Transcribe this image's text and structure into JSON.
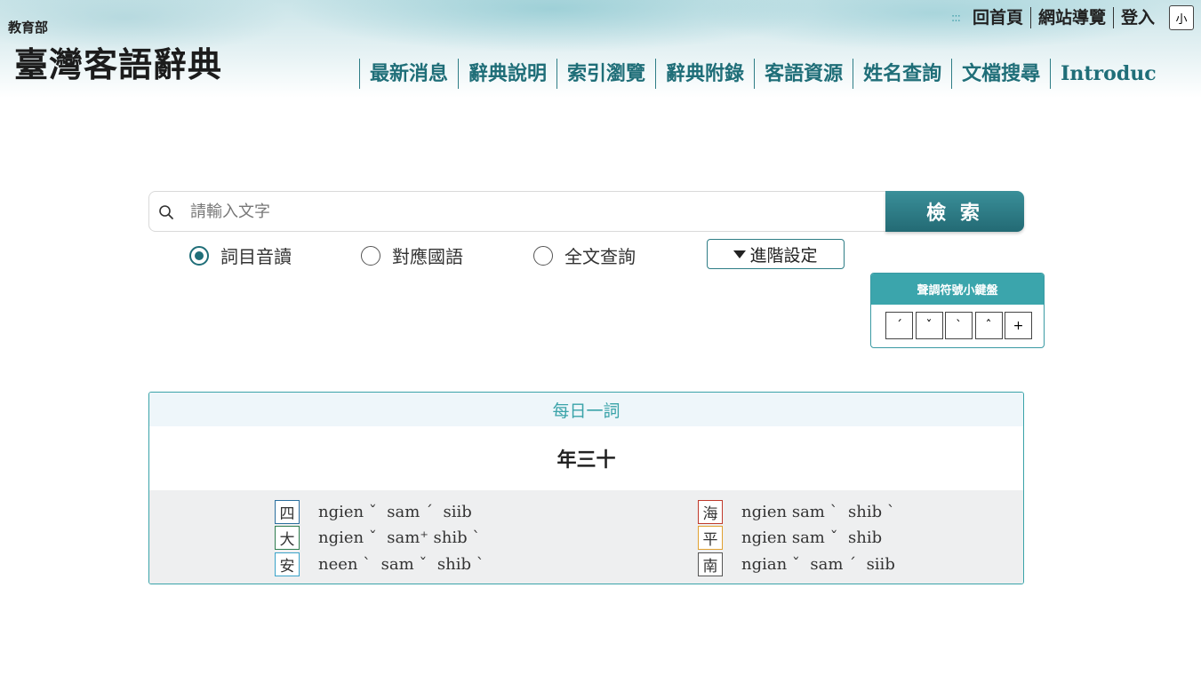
{
  "header": {
    "moe_label": "教育部",
    "site_title": "臺灣客語辭典",
    "top_links": [
      "回首頁",
      "網站導覽",
      "登入"
    ],
    "font_size_button": "小"
  },
  "nav": [
    "最新消息",
    "辭典說明",
    "索引瀏覽",
    "辭典附錄",
    "客語資源",
    "姓名查詢",
    "文檔搜尋",
    "Introduc"
  ],
  "search": {
    "placeholder": "請輸入文字",
    "button_label": "檢 索",
    "modes": [
      {
        "label": "詞目音讀",
        "checked": true
      },
      {
        "label": "對應國語",
        "checked": false
      },
      {
        "label": "全文查詢",
        "checked": false
      }
    ],
    "advanced_label": "進階設定"
  },
  "tone_keyboard": {
    "title": "聲調符號小鍵盤",
    "keys": [
      "ˊ",
      "ˇ",
      "ˋ",
      "ˆ",
      "+"
    ]
  },
  "daily_word": {
    "title": "每日一詞",
    "word": "年三十",
    "pronunciations": [
      {
        "dialect": "四",
        "text": "ngien ˇ  sam ˊ  siib",
        "color": "#2a6f9e"
      },
      {
        "dialect": "大",
        "text": "ngien ˇ  sam⁺ shib ˋ",
        "color": "#2e7d4f"
      },
      {
        "dialect": "安",
        "text": "neen ˋ  sam ˇ  shib ˋ",
        "color": "#3aa3c9"
      },
      {
        "dialect": "海",
        "text": "ngien sam ˋ  shib ˋ",
        "color": "#c0392b"
      },
      {
        "dialect": "平",
        "text": "ngien sam ˇ  shib",
        "color": "#e0a030"
      },
      {
        "dialect": "南",
        "text": "ngian ˇ  sam ˊ  siib",
        "color": "#555555"
      }
    ]
  },
  "colors": {
    "brand": "#1f6e78",
    "accent": "#3aa3a9"
  }
}
